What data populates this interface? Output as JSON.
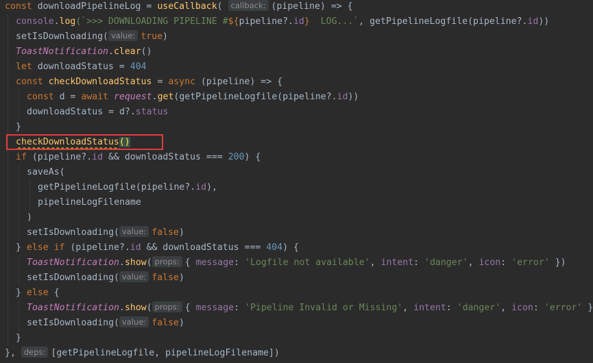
{
  "code_lines": [
    {
      "indent": 0,
      "tokens": [
        {
          "t": "const ",
          "c": "kw"
        },
        {
          "t": "downloadPipelineLog",
          "c": "id"
        },
        {
          "t": " = ",
          "c": "punc"
        },
        {
          "t": "useCallback",
          "c": "fn"
        },
        {
          "t": "( ",
          "c": "punc"
        },
        {
          "t": "callback:",
          "c": "hint"
        },
        {
          "t": "(pipeline) => {",
          "c": "punc"
        }
      ]
    },
    {
      "indent": 1,
      "tokens": [
        {
          "t": "console",
          "c": "prop"
        },
        {
          "t": ".",
          "c": "punc"
        },
        {
          "t": "log",
          "c": "fn"
        },
        {
          "t": "(`>>> DOWNLOADING PIPELINE #",
          "c": "str"
        },
        {
          "t": "${",
          "c": "kw"
        },
        {
          "t": "pipeline?.",
          "c": "id"
        },
        {
          "t": "id",
          "c": "prop"
        },
        {
          "t": "}",
          "c": "kw"
        },
        {
          "t": "  LOG...`",
          "c": "str"
        },
        {
          "t": ", getPipelineLogfile(pipeline?.",
          "c": "id"
        },
        {
          "t": "id",
          "c": "prop"
        },
        {
          "t": "))",
          "c": "punc"
        }
      ]
    },
    {
      "indent": 1,
      "tokens": [
        {
          "t": "setIsDownloading(",
          "c": "id"
        },
        {
          "t": "value:",
          "c": "hint"
        },
        {
          "t": "true",
          "c": "kw"
        },
        {
          "t": ")",
          "c": "punc"
        }
      ]
    },
    {
      "indent": 1,
      "tokens": [
        {
          "t": "ToastNotification",
          "c": "cls"
        },
        {
          "t": ".",
          "c": "punc"
        },
        {
          "t": "clear",
          "c": "fn"
        },
        {
          "t": "()",
          "c": "punc"
        }
      ]
    },
    {
      "indent": 1,
      "tokens": [
        {
          "t": "let ",
          "c": "kw"
        },
        {
          "t": "downloadStatus",
          "c": "id"
        },
        {
          "t": " = ",
          "c": "punc"
        },
        {
          "t": "404",
          "c": "num"
        }
      ]
    },
    {
      "indent": 1,
      "tokens": [
        {
          "t": "const ",
          "c": "kw"
        },
        {
          "t": "checkDownloadStatus",
          "c": "fn"
        },
        {
          "t": " = ",
          "c": "punc"
        },
        {
          "t": "async ",
          "c": "kw"
        },
        {
          "t": "(pipeline) => {",
          "c": "punc"
        }
      ]
    },
    {
      "indent": 2,
      "tokens": [
        {
          "t": "const ",
          "c": "kw"
        },
        {
          "t": "d",
          "c": "id"
        },
        {
          "t": " = ",
          "c": "punc"
        },
        {
          "t": "await ",
          "c": "kw"
        },
        {
          "t": "request",
          "c": "cls"
        },
        {
          "t": ".",
          "c": "punc"
        },
        {
          "t": "get",
          "c": "fn"
        },
        {
          "t": "(getPipelineLogfile(pipeline?.",
          "c": "id"
        },
        {
          "t": "id",
          "c": "prop"
        },
        {
          "t": "))",
          "c": "punc"
        }
      ]
    },
    {
      "indent": 2,
      "tokens": [
        {
          "t": "downloadStatus",
          "c": "id"
        },
        {
          "t": " = d?.",
          "c": "punc"
        },
        {
          "t": "status",
          "c": "prop"
        }
      ]
    },
    {
      "indent": 1,
      "tokens": [
        {
          "t": "}",
          "c": "punc"
        }
      ]
    },
    {
      "indent": 1,
      "tokens": [
        {
          "t": "checkDownloadStatus",
          "c": "warn"
        },
        {
          "t": "()",
          "c": "parenhl"
        }
      ]
    },
    {
      "indent": 1,
      "tokens": [
        {
          "t": "if ",
          "c": "kw"
        },
        {
          "t": "(pipeline?.",
          "c": "id"
        },
        {
          "t": "id",
          "c": "prop"
        },
        {
          "t": " && downloadStatus === ",
          "c": "punc"
        },
        {
          "t": "200",
          "c": "num"
        },
        {
          "t": ") {",
          "c": "punc"
        }
      ]
    },
    {
      "indent": 2,
      "tokens": [
        {
          "t": "saveAs(",
          "c": "id"
        }
      ]
    },
    {
      "indent": 3,
      "tokens": [
        {
          "t": "getPipelineLogfile(pipeline?.",
          "c": "id"
        },
        {
          "t": "id",
          "c": "prop"
        },
        {
          "t": "),",
          "c": "punc"
        }
      ]
    },
    {
      "indent": 3,
      "tokens": [
        {
          "t": "pipelineLogFilename",
          "c": "id"
        }
      ]
    },
    {
      "indent": 2,
      "tokens": [
        {
          "t": ")",
          "c": "punc"
        }
      ]
    },
    {
      "indent": 2,
      "tokens": [
        {
          "t": "setIsDownloading(",
          "c": "id"
        },
        {
          "t": "value:",
          "c": "hint"
        },
        {
          "t": "false",
          "c": "kw"
        },
        {
          "t": ")",
          "c": "punc"
        }
      ]
    },
    {
      "indent": 1,
      "tokens": [
        {
          "t": "} ",
          "c": "punc"
        },
        {
          "t": "else if ",
          "c": "kw"
        },
        {
          "t": "(pipeline?.",
          "c": "id"
        },
        {
          "t": "id",
          "c": "prop"
        },
        {
          "t": " && downloadStatus === ",
          "c": "punc"
        },
        {
          "t": "404",
          "c": "num"
        },
        {
          "t": ") {",
          "c": "punc"
        }
      ]
    },
    {
      "indent": 2,
      "tokens": [
        {
          "t": "ToastNotification",
          "c": "cls"
        },
        {
          "t": ".",
          "c": "punc"
        },
        {
          "t": "show",
          "c": "fn"
        },
        {
          "t": "(",
          "c": "punc"
        },
        {
          "t": "props:",
          "c": "hint"
        },
        {
          "t": "{ ",
          "c": "punc"
        },
        {
          "t": "message",
          "c": "prop"
        },
        {
          "t": ": ",
          "c": "punc"
        },
        {
          "t": "'Logfile not available'",
          "c": "str"
        },
        {
          "t": ", ",
          "c": "punc"
        },
        {
          "t": "intent",
          "c": "prop"
        },
        {
          "t": ": ",
          "c": "punc"
        },
        {
          "t": "'danger'",
          "c": "str"
        },
        {
          "t": ", ",
          "c": "punc"
        },
        {
          "t": "icon",
          "c": "prop"
        },
        {
          "t": ": ",
          "c": "punc"
        },
        {
          "t": "'error'",
          "c": "str"
        },
        {
          "t": " })",
          "c": "punc"
        }
      ]
    },
    {
      "indent": 2,
      "tokens": [
        {
          "t": "setIsDownloading(",
          "c": "id"
        },
        {
          "t": "value:",
          "c": "hint"
        },
        {
          "t": "false",
          "c": "kw"
        },
        {
          "t": ")",
          "c": "punc"
        }
      ]
    },
    {
      "indent": 1,
      "tokens": [
        {
          "t": "} ",
          "c": "punc"
        },
        {
          "t": "else ",
          "c": "kw"
        },
        {
          "t": "{",
          "c": "punc"
        }
      ]
    },
    {
      "indent": 2,
      "tokens": [
        {
          "t": "ToastNotification",
          "c": "cls"
        },
        {
          "t": ".",
          "c": "punc"
        },
        {
          "t": "show",
          "c": "fn"
        },
        {
          "t": "(",
          "c": "punc"
        },
        {
          "t": "props:",
          "c": "hint"
        },
        {
          "t": "{ ",
          "c": "punc"
        },
        {
          "t": "message",
          "c": "prop"
        },
        {
          "t": ": ",
          "c": "punc"
        },
        {
          "t": "'Pipeline Invalid or Missing'",
          "c": "str"
        },
        {
          "t": ", ",
          "c": "punc"
        },
        {
          "t": "intent",
          "c": "prop"
        },
        {
          "t": ": ",
          "c": "punc"
        },
        {
          "t": "'danger'",
          "c": "str"
        },
        {
          "t": ", ",
          "c": "punc"
        },
        {
          "t": "icon",
          "c": "prop"
        },
        {
          "t": ": ",
          "c": "punc"
        },
        {
          "t": "'error'",
          "c": "str"
        },
        {
          "t": " })",
          "c": "punc"
        }
      ]
    },
    {
      "indent": 2,
      "tokens": [
        {
          "t": "setIsDownloading(",
          "c": "id"
        },
        {
          "t": "value:",
          "c": "hint"
        },
        {
          "t": "false",
          "c": "kw"
        },
        {
          "t": ")",
          "c": "punc"
        }
      ]
    },
    {
      "indent": 1,
      "tokens": [
        {
          "t": "}",
          "c": "punc"
        }
      ]
    },
    {
      "indent": 0,
      "tokens": [
        {
          "t": "}, ",
          "c": "punc"
        },
        {
          "t": "deps:",
          "c": "hint"
        },
        {
          "t": "[getPipelineLogfile, pipelineLogFilename])",
          "c": "id"
        }
      ]
    }
  ],
  "highlighted_line": 9,
  "colors": {
    "background": "#2b2b2b",
    "highlight_border": "#e23b3b"
  }
}
